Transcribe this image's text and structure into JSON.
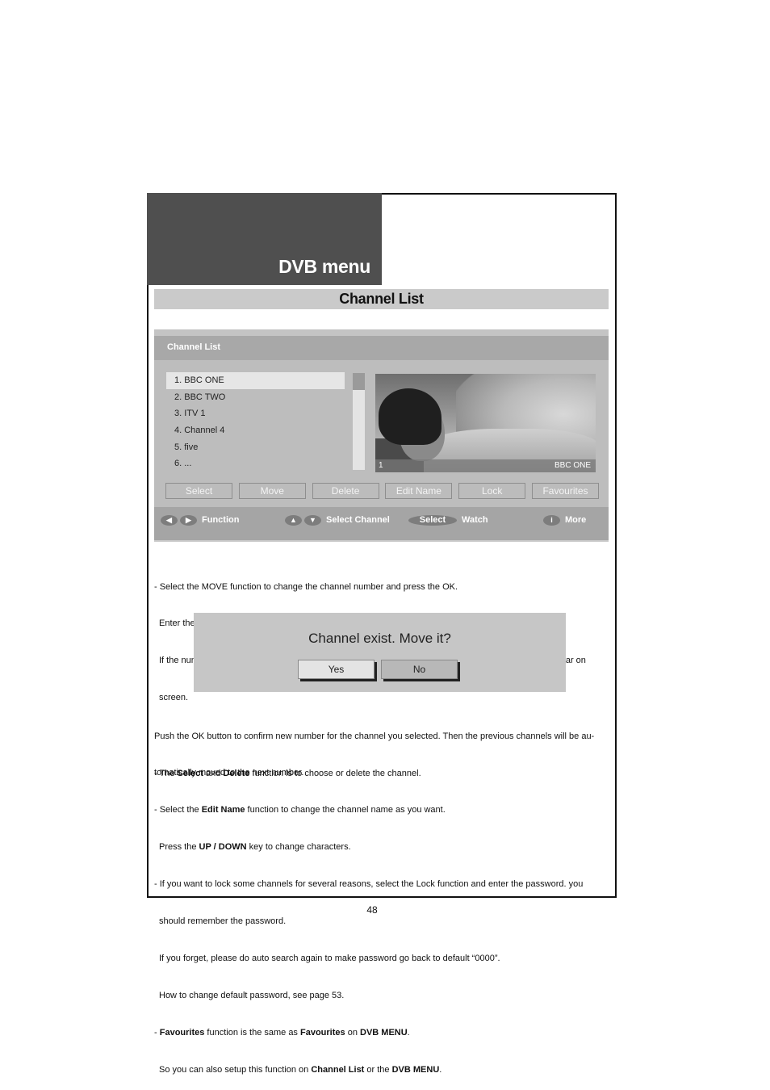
{
  "header": {
    "title": "DVB menu"
  },
  "section": {
    "title": "Channel List"
  },
  "tv_screen": {
    "title": "Channel List",
    "channels": [
      {
        "label": "1. BBC ONE",
        "selected": true
      },
      {
        "label": "2. BBC TWO",
        "selected": false
      },
      {
        "label": "3. ITV 1",
        "selected": false
      },
      {
        "label": "4. Channel 4",
        "selected": false
      },
      {
        "label": "5. five",
        "selected": false
      },
      {
        "label": "6. ...",
        "selected": false
      }
    ],
    "preview": {
      "number": "1",
      "name": "BBC ONE",
      "image": "woman-with-camel-photo"
    },
    "functions": [
      "Select",
      "Move",
      "Delete",
      "Edit Name",
      "Lock",
      "Favourites"
    ],
    "help": {
      "function": {
        "keys": [
          "left-arrow-icon",
          "right-arrow-icon"
        ],
        "label": "Function"
      },
      "select_channel": {
        "keys": [
          "up-arrow-icon",
          "down-arrow-icon"
        ],
        "label": "Select Channel"
      },
      "watch": {
        "key_label": "Select",
        "label": "Watch"
      },
      "more": {
        "key_label": "i",
        "label": "More"
      }
    }
  },
  "instructions_move": {
    "line1": "- Select the MOVE function to change the channel number and press the OK.",
    "line2": "Enter the new number you want and press the OK button.",
    "line3": "If the number you are selecting is already memorised for another channel, a warning message will appear on",
    "line4": "screen."
  },
  "dialog": {
    "message": "Channel exist. Move it?",
    "yes_label": "Yes",
    "no_label": "No"
  },
  "instructions_confirm": {
    "line1": "Push the OK button to confirm new number for the channel you selected. Then the previous channels will be au-",
    "line2": "tomatically moved to the next number."
  },
  "notes": {
    "select_delete": {
      "prefix": "- The ",
      "b1": "Select",
      "mid": " and ",
      "b2": "Delete",
      "suffix": " function is to choose or delete the channel."
    },
    "edit_name": {
      "prefix": "- Select the ",
      "b1": "Edit Name",
      "suffix": " function to change the channel name as you want."
    },
    "updown": {
      "prefix": "Press the ",
      "b1": "UP / DOWN",
      "suffix": " key to change characters."
    },
    "lock1": "- If you want to lock some channels for several reasons, select the Lock function and enter the password. you",
    "lock2": "should remember the password.",
    "lock3": "If you forget, please do auto search again to make password go back to default “0000”.",
    "lock4": "How to change default password, see page 53.",
    "fav1": {
      "prefix": "- ",
      "b1": "Favourites",
      "mid": " function is the same as ",
      "b2": "Favourites",
      "mid2": " on ",
      "b3": "DVB MENU",
      "suffix": "."
    },
    "fav2": {
      "prefix": "So you can also setup this function on ",
      "b1": "Channel List",
      "mid": " or the ",
      "b2": "DVB MENU",
      "suffix": "."
    }
  },
  "page_number": "48"
}
